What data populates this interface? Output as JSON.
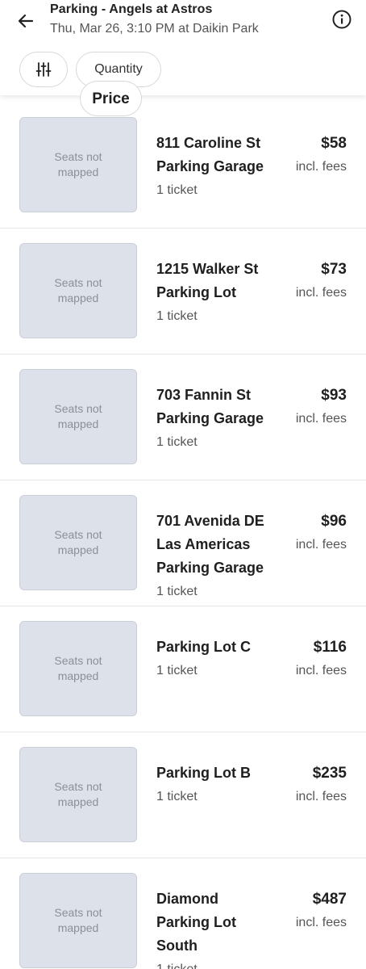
{
  "header": {
    "title": "Parking - Angels at Astros",
    "subtitle": "Thu, Mar 26, 3:10 PM at Daikin Park",
    "back_icon": "arrow-left-icon",
    "info_icon": "info-icon"
  },
  "filters": {
    "filter_icon": "sliders-icon",
    "quantity_label": "Quantity",
    "price_label": "Price"
  },
  "listings": [
    {
      "thumb_text": "Seats not mapped",
      "name_lines": [
        "811 Caroline St",
        "Parking Garage"
      ],
      "tickets": "1 ticket",
      "price": "$58",
      "fees": "incl. fees"
    },
    {
      "thumb_text": "Seats not mapped",
      "name_lines": [
        "1215 Walker St",
        "Parking Lot"
      ],
      "tickets": "1 ticket",
      "price": "$73",
      "fees": "incl. fees"
    },
    {
      "thumb_text": "Seats not mapped",
      "name_lines": [
        "703 Fannin St",
        "Parking Garage"
      ],
      "tickets": "1 ticket",
      "price": "$93",
      "fees": "incl. fees"
    },
    {
      "thumb_text": "Seats not mapped",
      "name_lines": [
        "701 Avenida DE",
        "Las Americas",
        "Parking Garage"
      ],
      "tickets": "1 ticket",
      "price": "$96",
      "fees": "incl. fees"
    },
    {
      "thumb_text": "Seats not mapped",
      "name_lines": [
        "Parking Lot C"
      ],
      "tickets": "1 ticket",
      "price": "$116",
      "fees": "incl. fees"
    },
    {
      "thumb_text": "Seats not mapped",
      "name_lines": [
        "Parking Lot B"
      ],
      "tickets": "1 ticket",
      "price": "$235",
      "fees": "incl. fees"
    },
    {
      "thumb_text": "Seats not mapped",
      "name_lines": [
        "Diamond",
        "Parking Lot",
        "South"
      ],
      "tickets": "1 ticket",
      "price": "$487",
      "fees": "incl. fees"
    }
  ]
}
